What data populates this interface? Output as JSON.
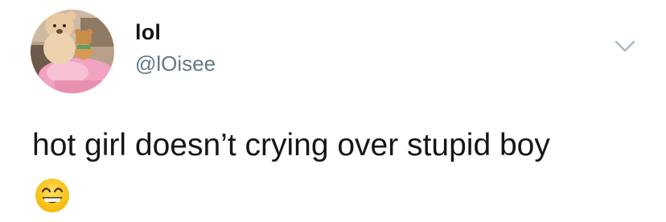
{
  "tweet": {
    "author": {
      "display_name": "lol",
      "handle": "@lOisee",
      "avatar_icon": "teddy-bear-avatar"
    },
    "menu_icon": "chevron-down-icon",
    "text": "hot girl doesn’t crying over stupid boy",
    "emoji": "grinning-face-with-smiling-eyes"
  },
  "colors": {
    "text": "#14171a",
    "secondary_text": "#657786",
    "chevron": "#aab8c2",
    "emoji_face": "#ffcc33"
  }
}
